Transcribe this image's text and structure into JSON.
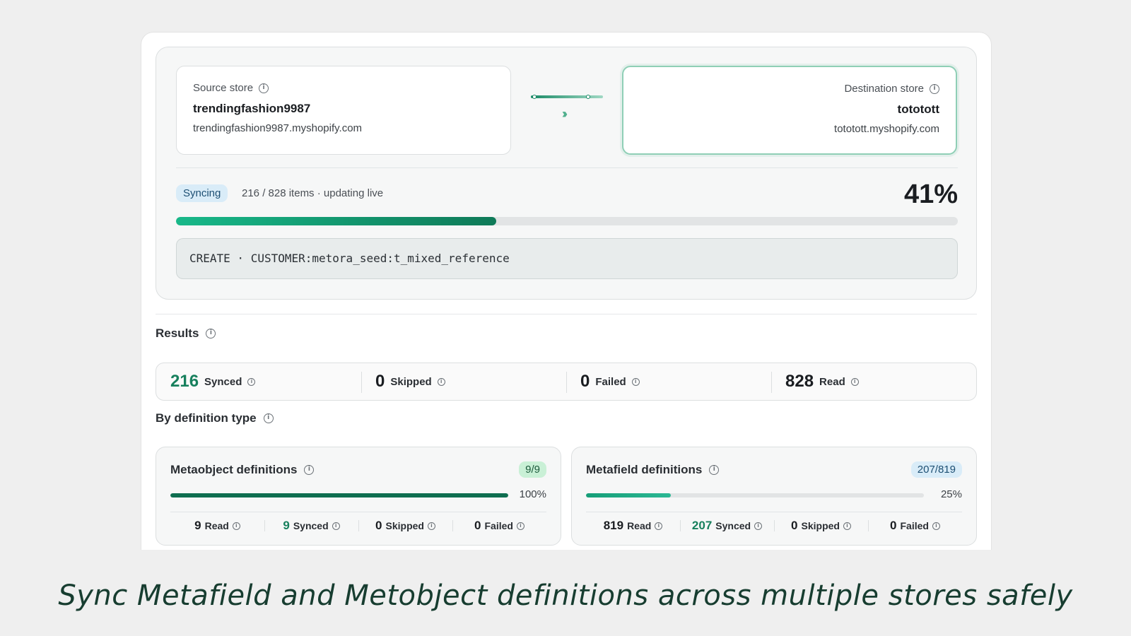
{
  "source_store": {
    "label": "Source store",
    "name": "trendingfashion9987",
    "url": "trendingfashion9987.myshopify.com"
  },
  "destination_store": {
    "label": "Destination store",
    "name": "tototott",
    "url": "tototott.myshopify.com"
  },
  "sync": {
    "status_badge": "Syncing",
    "status_text": "216 / 828 items · updating live",
    "percent_label": "41%",
    "progress": 0.41,
    "current_operation": "CREATE · CUSTOMER:metora_seed:t_mixed_reference"
  },
  "results": {
    "title": "Results",
    "synced": {
      "value": "216",
      "label": "Synced"
    },
    "skipped": {
      "value": "0",
      "label": "Skipped"
    },
    "failed": {
      "value": "0",
      "label": "Failed"
    },
    "read": {
      "value": "828",
      "label": "Read"
    }
  },
  "by_type": {
    "title": "By definition type",
    "metaobject": {
      "title": "Metaobject definitions",
      "badge": "9/9",
      "percent_label": "100%",
      "progress": 1.0,
      "read": {
        "value": "9",
        "label": "Read"
      },
      "synced": {
        "value": "9",
        "label": "Synced"
      },
      "skipped": {
        "value": "0",
        "label": "Skipped"
      },
      "failed": {
        "value": "0",
        "label": "Failed"
      }
    },
    "metafield": {
      "title": "Metafield definitions",
      "badge": "207/819",
      "percent_label": "25%",
      "progress": 0.25,
      "read": {
        "value": "819",
        "label": "Read"
      },
      "synced": {
        "value": "207",
        "label": "Synced"
      },
      "skipped": {
        "value": "0",
        "label": "Skipped"
      },
      "failed": {
        "value": "0",
        "label": "Failed"
      }
    }
  },
  "caption": "Sync Metafield and Metobject definitions across multiple stores safely",
  "colors": {
    "accent_green": "#17805d",
    "syncing_badge_bg": "#d9ecf8",
    "page_bg": "#efefef"
  },
  "icons": {
    "info": "info-icon",
    "sync_arrows": "double-chevron-right-icon"
  }
}
